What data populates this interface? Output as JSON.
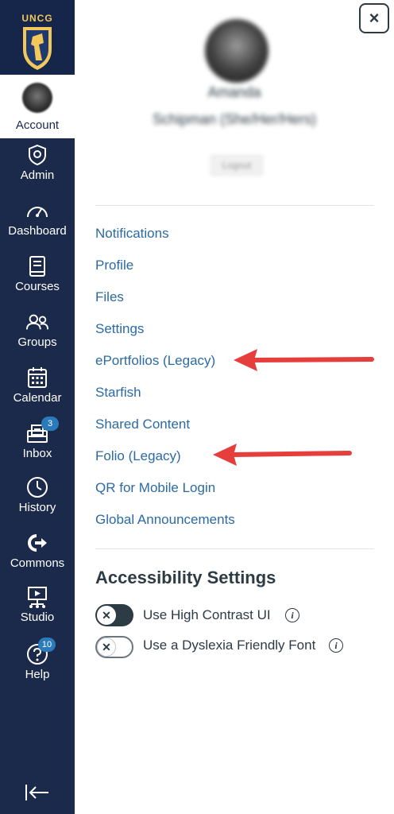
{
  "sidebar": {
    "logo_text": "UNCG",
    "items": [
      {
        "label": "Account",
        "icon": "account-avatar",
        "badge": ""
      },
      {
        "label": "Admin",
        "icon": "admin-shield-icon",
        "badge": ""
      },
      {
        "label": "Dashboard",
        "icon": "dashboard-gauge-icon",
        "badge": ""
      },
      {
        "label": "Courses",
        "icon": "courses-book-icon",
        "badge": ""
      },
      {
        "label": "Groups",
        "icon": "groups-people-icon",
        "badge": ""
      },
      {
        "label": "Calendar",
        "icon": "calendar-icon",
        "badge": ""
      },
      {
        "label": "Inbox",
        "icon": "inbox-icon",
        "badge": "3"
      },
      {
        "label": "History",
        "icon": "history-clock-icon",
        "badge": ""
      },
      {
        "label": "Commons",
        "icon": "commons-arrow-icon",
        "badge": ""
      },
      {
        "label": "Studio",
        "icon": "studio-icon",
        "badge": ""
      },
      {
        "label": "Help",
        "icon": "help-icon",
        "badge": "10"
      }
    ],
    "collapse_icon": "collapse-arrow-icon"
  },
  "panel": {
    "close_symbol": "×",
    "user_first": "Amanda",
    "user_last": "Schipman (She/Her/Hers)",
    "logout_label": "Logout",
    "links": [
      "Notifications",
      "Profile",
      "Files",
      "Settings",
      "ePortfolios (Legacy)",
      "Starfish",
      "Shared Content",
      "Folio (Legacy)",
      "QR for Mobile Login",
      "Global Announcements"
    ],
    "accessibility_title": "Accessibility Settings",
    "toggles": [
      {
        "label": "Use High Contrast UI",
        "on": true
      },
      {
        "label": "Use a Dyslexia Friendly Font",
        "on": false
      }
    ],
    "toggle_symbol": "✕",
    "info_symbol": "i"
  },
  "colors": {
    "sidebar_bg": "#1b2a4a",
    "link": "#2b6aa3",
    "arrow": "#e63d3d",
    "badge": "#2b7abc"
  }
}
